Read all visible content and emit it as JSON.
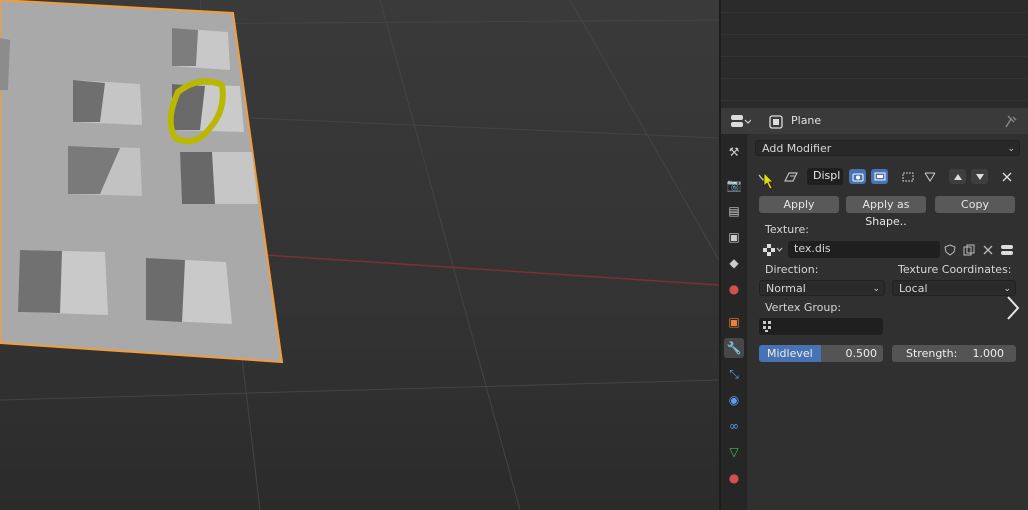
{
  "header": {
    "object_name": "Plane"
  },
  "modifier_panel": {
    "add_modifier_label": "Add Modifier",
    "modifier_name": "Displ",
    "apply_label": "Apply",
    "apply_as_shape_label": "Apply as Shape..",
    "copy_label": "Copy",
    "texture_label": "Texture:",
    "texture_name": "tex.dis",
    "direction_label": "Direction:",
    "direction_value": "Normal",
    "texture_coords_label": "Texture Coordinates:",
    "texture_coords_value": "Local",
    "vertex_group_label": "Vertex Group:",
    "vertex_group_value": "",
    "midlevel_label": "Midlevel",
    "midlevel_value": "0.500",
    "midlevel_fraction": 0.5,
    "strength_label": "Strength:",
    "strength_value": "1.000"
  },
  "colors": {
    "accent_blue": "#4772b3",
    "selected_outline": "#f29d38",
    "highlight_marker": "#b9b800",
    "x_axis_red": "#7a3038"
  },
  "icons": {
    "editor_type": "properties-editor-icon",
    "object_data": "object-icon",
    "pin": "pin-icon",
    "tool": "tool-icon",
    "render": "render-icon",
    "output": "printer-icon",
    "view_layer": "image-icon",
    "scene": "scene-icon",
    "world": "world-icon",
    "object": "object-orange-icon",
    "modifiers": "wrench-icon",
    "particles": "particles-icon",
    "physics": "physics-icon",
    "constraints": "constraints-icon",
    "data": "mesh-data-icon",
    "material": "material-icon"
  }
}
